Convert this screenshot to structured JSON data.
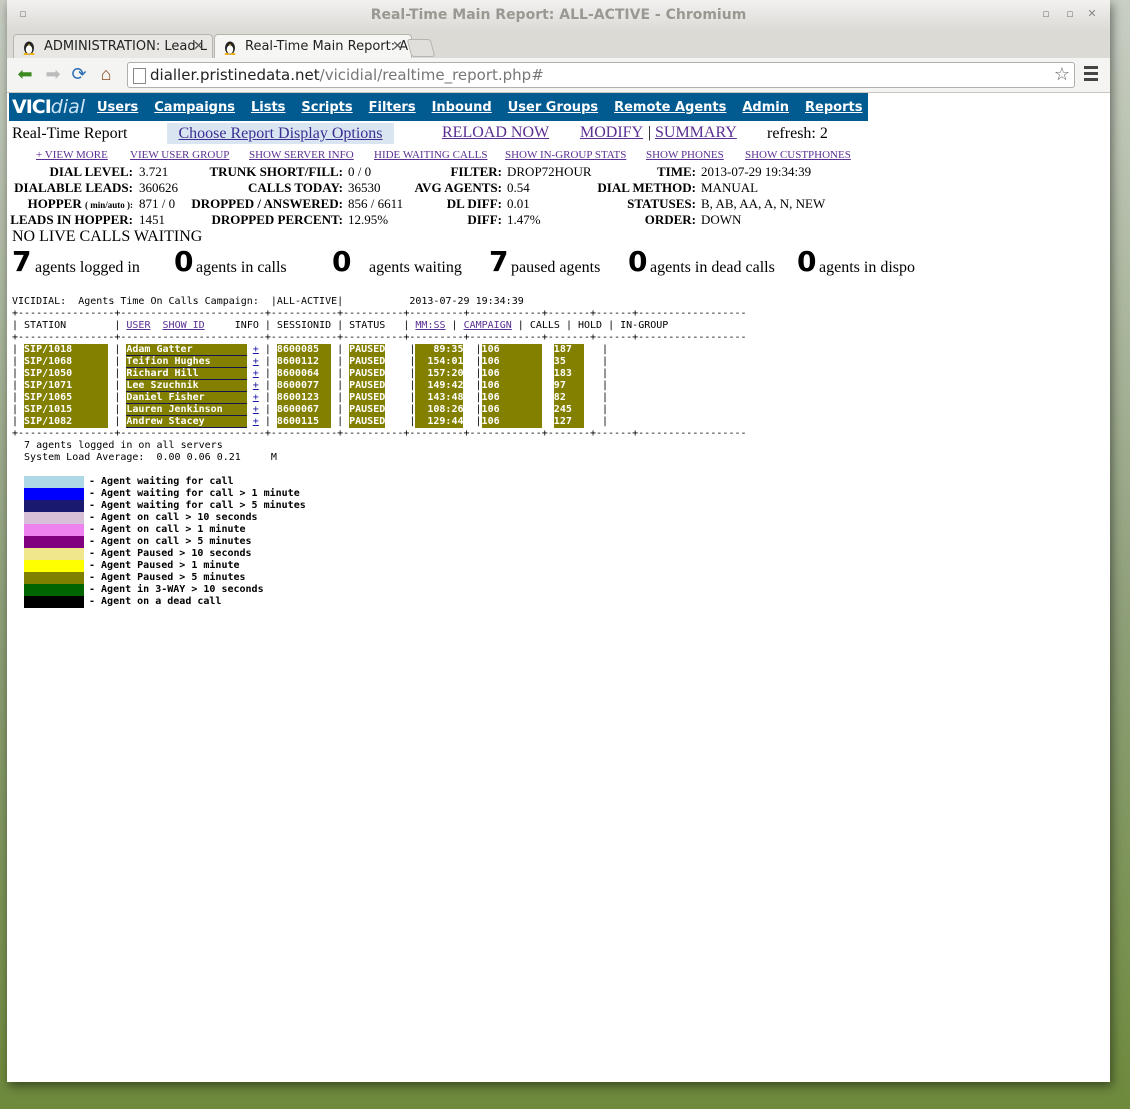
{
  "window_title": "Real-Time Main Report: ALL-ACTIVE - Chromium",
  "tabs": [
    {
      "label": "ADMINISTRATION: Lead L",
      "active": false
    },
    {
      "label": "Real-Time Main Report: A",
      "active": true
    }
  ],
  "url": {
    "host": "dialler.pristinedata.net",
    "path": "/vicidial/realtime_report.php#"
  },
  "nav": {
    "logo_bold": "VICI",
    "logo_italic": "dial",
    "items": [
      "Users",
      "Campaigns",
      "Lists",
      "Scripts",
      "Filters",
      "Inbound",
      "User Groups",
      "Remote Agents",
      "Admin",
      "Reports"
    ]
  },
  "report": {
    "title": "Real-Time Report",
    "choose": "Choose Report Display Options",
    "reload": "RELOAD NOW",
    "modify": "MODIFY",
    "sep": "|",
    "summary": "SUMMARY",
    "refresh": "refresh: 2"
  },
  "sublinks": [
    "+ VIEW MORE",
    "VIEW USER GROUP",
    "SHOW SERVER INFO",
    "HIDE WAITING CALLS",
    "SHOW IN-GROUP STATS",
    "SHOW PHONES",
    "SHOW CUSTPHONES"
  ],
  "stats": {
    "dial_level_l": "DIAL LEVEL:",
    "dial_level": "3.721",
    "trunk_l": "TRUNK SHORT/FILL:",
    "trunk": "0 / 0",
    "filter_l": "FILTER:",
    "filter": "DROP72HOUR",
    "time_l": "TIME:",
    "time": "2013-07-29 19:34:39",
    "dialable_l": "DIALABLE LEADS:",
    "dialable": "360626",
    "calls_today_l": "CALLS TODAY:",
    "calls_today": "36530",
    "avg_agents_l": "AVG AGENTS:",
    "avg_agents": "0.54",
    "dial_method_l": "DIAL METHOD:",
    "dial_method": "MANUAL",
    "hopper_l": "HOPPER",
    "hopper_small": "( min/auto ):",
    "hopper": "871 / 0",
    "dropped_l": "DROPPED / ANSWERED:",
    "dropped": "856 / 6611",
    "dl_diff_l": "DL DIFF:",
    "dl_diff": "0.01",
    "statuses_l": "STATUSES:",
    "statuses": "B, AB, AA, A, N, NEW",
    "leads_hopper_l": "LEADS IN HOPPER:",
    "leads_hopper": "1451",
    "dropped_pct_l": "DROPPED PERCENT:",
    "dropped_pct": "12.95%",
    "diff_l": "DIFF:",
    "diff": "1.47%",
    "order_l": "ORDER:",
    "order": "DOWN"
  },
  "no_live": "NO LIVE CALLS WAITING",
  "summary_counts": [
    {
      "n": "7",
      "label": "agents logged in"
    },
    {
      "n": "0",
      "label": "agents in calls"
    },
    {
      "n": "0",
      "label": "agents waiting"
    },
    {
      "n": "7",
      "label": "paused agents"
    },
    {
      "n": "0",
      "label": "agents in dead calls"
    },
    {
      "n": "0",
      "label": "agents in dispo"
    }
  ],
  "table": {
    "caption": "VICIDIAL:  Agents Time On Calls Campaign:  |ALL-ACTIVE|           2013-07-29 19:34:39",
    "border": "+----------------+------------------------+-----------+----------+---------+------------+-------+------+------------------",
    "header_prefix": "| STATION        | ",
    "h_user": "USER",
    "h_showid": "SHOW ID",
    "header_mid": "     INFO | SESSIONID | STATUS   | ",
    "h_mmss": "MM:SS",
    "h_campaign": "CAMPAIGN",
    "header_end": "| CALLS | HOLD | IN-GROUP",
    "rows": [
      {
        "station": "SIP/1018",
        "user": "Adam Gatter",
        "session": "8600085",
        "status": "PAUSED",
        "mmss": "89:35",
        "campaign": "106",
        "calls": "187"
      },
      {
        "station": "SIP/1068",
        "user": "Teifion Hughes",
        "session": "8600112",
        "status": "PAUSED",
        "mmss": "154:01",
        "campaign": "106",
        "calls": "35"
      },
      {
        "station": "SIP/1050",
        "user": "Richard Hill",
        "session": "8600064",
        "status": "PAUSED",
        "mmss": "157:20",
        "campaign": "106",
        "calls": "183"
      },
      {
        "station": "SIP/1071",
        "user": "Lee Szuchnik",
        "session": "8600077",
        "status": "PAUSED",
        "mmss": "149:42",
        "campaign": "106",
        "calls": "97"
      },
      {
        "station": "SIP/1065",
        "user": "Daniel Fisher",
        "session": "8600123",
        "status": "PAUSED",
        "mmss": "143:48",
        "campaign": "106",
        "calls": "82"
      },
      {
        "station": "SIP/1015",
        "user": "Lauren Jenkinson",
        "session": "8600067",
        "status": "PAUSED",
        "mmss": "108:26",
        "campaign": "106",
        "calls": "245"
      },
      {
        "station": "SIP/1082",
        "user": "Andrew Stacey",
        "session": "8600115",
        "status": "PAUSED",
        "mmss": "129:44",
        "campaign": "106",
        "calls": "127"
      }
    ],
    "plus": "+",
    "footer1": "  7 agents logged in on all servers",
    "footer2": "  System Load Average:  0.00 0.06 0.21     M"
  },
  "legend": [
    {
      "color": "#add8e6",
      "text": "- Agent waiting for call"
    },
    {
      "color": "#0000ff",
      "text": "- Agent waiting for call > 1 minute"
    },
    {
      "color": "#191970",
      "text": "- Agent waiting for call > 5 minutes"
    },
    {
      "color": "#d8bfd8",
      "text": "- Agent on call > 10 seconds"
    },
    {
      "color": "#ee82ee",
      "text": "- Agent on call > 1 minute"
    },
    {
      "color": "#800080",
      "text": "- Agent on call > 5 minutes"
    },
    {
      "color": "#f0e68c",
      "text": "- Agent Paused > 10 seconds"
    },
    {
      "color": "#ffff00",
      "text": "- Agent Paused > 1 minute"
    },
    {
      "color": "#808000",
      "text": "- Agent Paused > 5 minutes"
    },
    {
      "color": "#006400",
      "text": "- Agent in 3-WAY > 10 seconds"
    },
    {
      "color": "#000000",
      "text": "- Agent on a dead call"
    }
  ]
}
